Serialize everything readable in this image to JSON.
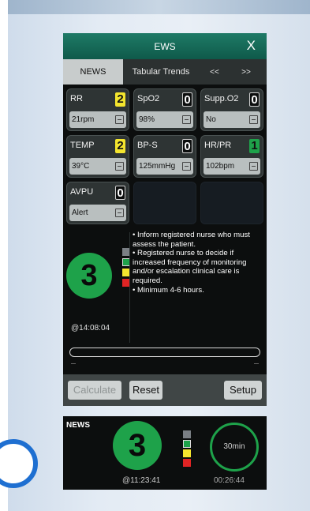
{
  "window": {
    "title": "EWS",
    "close_label": "X"
  },
  "tabs": [
    {
      "label": "NEWS",
      "active": true
    },
    {
      "label": "Tabular Trends",
      "active": false
    },
    {
      "label": "<<",
      "active": false
    },
    {
      "label": ">>",
      "active": false
    }
  ],
  "params": [
    {
      "label": "RR",
      "score": "2",
      "value": "21rpm",
      "color": "#f4e52e"
    },
    {
      "label": "SpO2",
      "score": "0",
      "value": "98%",
      "color": "#0c0e0e"
    },
    {
      "label": "Supp.O2",
      "score": "0",
      "value": "No",
      "color": "#0c0e0e"
    },
    {
      "label": "TEMP",
      "score": "2",
      "value": "39°C",
      "color": "#f4e52e"
    },
    {
      "label": "BP-S",
      "score": "0",
      "value": "125mmHg",
      "color": "#0c0e0e"
    },
    {
      "label": "HR/PR",
      "score": "1",
      "value": "102bpm",
      "color": "#1ea24a"
    },
    {
      "label": "AVPU",
      "score": "0",
      "value": "Alert",
      "color": "#0c0e0e"
    }
  ],
  "result": {
    "total_score": "3",
    "time": "@14:08:04",
    "advice": [
      "• Inform registered nurse who must assess the patient.",
      "• Registered nurse to decide if increased frequency of monitoring and/or escalation clinical care is required.",
      "• Minimum 4-6 hours."
    ]
  },
  "buttons": {
    "calculate": "Calculate",
    "reset": "Reset",
    "setup": "Setup"
  },
  "strip": {
    "label": "NEWS",
    "score": "3",
    "time": "@11:23:41",
    "interval": "30min",
    "elapsed": "00:26:44"
  }
}
